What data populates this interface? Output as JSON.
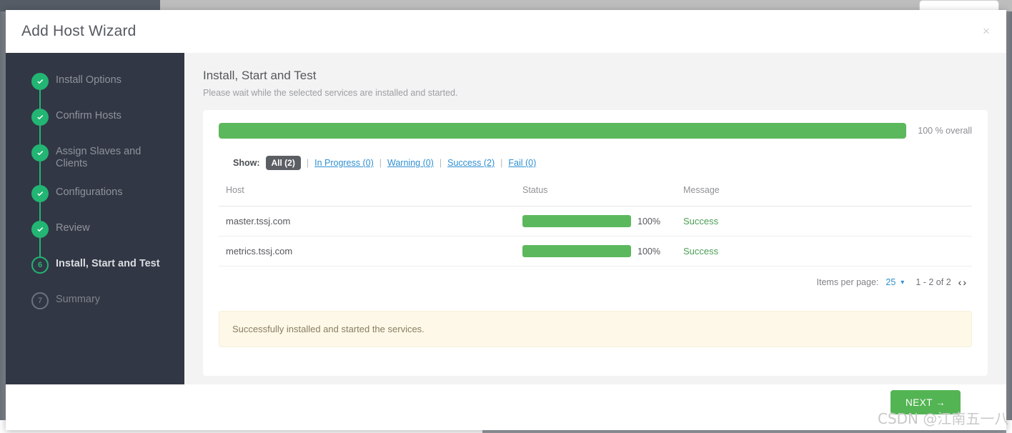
{
  "modal": {
    "title": "Add Host Wizard",
    "close_label": "×"
  },
  "sidebar": {
    "steps": [
      {
        "number": "1",
        "label": "Install Options",
        "state": "done"
      },
      {
        "number": "2",
        "label": "Confirm Hosts",
        "state": "done"
      },
      {
        "number": "3",
        "label": "Assign Slaves and Clients",
        "state": "done"
      },
      {
        "number": "4",
        "label": "Configurations",
        "state": "done"
      },
      {
        "number": "5",
        "label": "Review",
        "state": "done"
      },
      {
        "number": "6",
        "label": "Install, Start and Test",
        "state": "current"
      },
      {
        "number": "7",
        "label": "Summary",
        "state": "pending"
      }
    ]
  },
  "content": {
    "title": "Install, Start and Test",
    "subtitle": "Please wait while the selected services are installed and started."
  },
  "overall": {
    "percent": 100,
    "text": "100 % overall"
  },
  "filters": {
    "label": "Show:",
    "separator": "|",
    "items": [
      {
        "label": "All (2)",
        "active": true
      },
      {
        "label": "In Progress (0)",
        "active": false
      },
      {
        "label": "Warning (0)",
        "active": false
      },
      {
        "label": "Success (2)",
        "active": false
      },
      {
        "label": "Fail (0)",
        "active": false
      }
    ]
  },
  "table": {
    "columns": [
      "Host",
      "Status",
      "Message"
    ],
    "rows": [
      {
        "host": "master.tssj.com",
        "percent": 100,
        "percent_label": "100%",
        "message": "Success"
      },
      {
        "host": "metrics.tssj.com",
        "percent": 100,
        "percent_label": "100%",
        "message": "Success"
      }
    ]
  },
  "pagination": {
    "items_per_page_label": "Items per page:",
    "items_per_page_value": "25",
    "caret": "▾",
    "range": "1 - 2 of 2",
    "prev": "‹",
    "next": "›"
  },
  "alert": {
    "message": "Successfully installed and started the services."
  },
  "footer": {
    "next_label": "NEXT",
    "next_arrow": "→"
  },
  "watermark": {
    "text": "CSDN @江南五一八"
  },
  "colors": {
    "green": "#5cb85c",
    "marker_green": "#22b573",
    "sidebar": "#323745",
    "link": "#2e8fd1",
    "alert_bg": "#fdf8e7"
  }
}
